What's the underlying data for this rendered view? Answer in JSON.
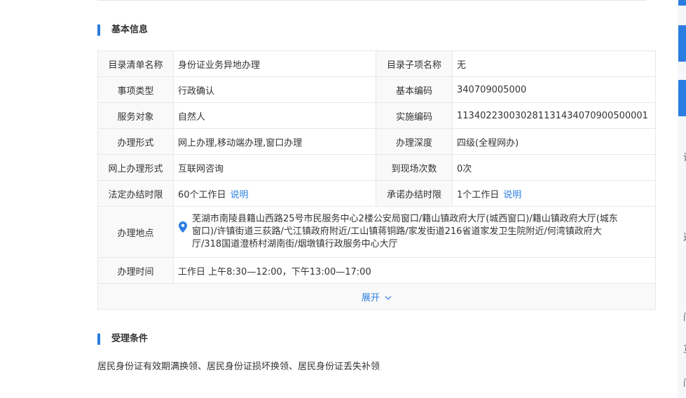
{
  "basic_info": {
    "title": "基本信息",
    "rows": [
      {
        "label1": "目录清单名称",
        "value1": "身份证业务异地办理",
        "label2": "目录子项名称",
        "value2": "无"
      },
      {
        "label1": "事项类型",
        "value1": "行政确认",
        "label2": "基本编码",
        "value2": "340709005000"
      },
      {
        "label1": "服务对象",
        "value1": "自然人",
        "label2": "实施编码",
        "value2": "11340223003028113143407090050000​1"
      },
      {
        "label1": "办理形式",
        "value1": "网上办理,移动端办理,窗口办理",
        "label2": "办理深度",
        "value2": "四级(全程网办)"
      },
      {
        "label1": "网上办理形式",
        "value1": "互联网咨询",
        "label2": "到现场次数",
        "value2": "0次"
      }
    ],
    "time_limit": {
      "label1": "法定办结时限",
      "value1": "60个工作日",
      "link1": "说明",
      "label2": "承诺办结时限",
      "value2": "1个工作日",
      "link2": "说明"
    },
    "location": {
      "label": "办理地点",
      "icon": "location-pin-icon",
      "value": "芜湖市南陵县籍山西路25号市民服务中心2楼公安局窗口/籍山镇政府大厅(城西窗口)/籍山镇政府大厅(城东窗口)/许镇街道三荻路/弋江镇政府附近/工山镇蒋铜路/家发街道216省道家发卫生院附近/何湾镇政府大厅/318国道澄桥村湖南街/烟墩镇行政服务中心大厅"
    },
    "hours": {
      "label": "办理时间",
      "value": "工作日 上午8:30—12:00，下午13:00—17:00"
    },
    "expand": {
      "label": "展开",
      "icon": "chevron-down-icon"
    }
  },
  "conditions": {
    "title": "受理条件",
    "text": "居民身份证有效期满换领、居民身份证损坏换领、居民身份证丢失补领"
  },
  "sidebar_chars": [
    "诊",
    "迟",
    "问",
    "互",
    "问"
  ],
  "colors": {
    "accent": "#2b7de1",
    "label_bg": "#f9f9f9",
    "border": "#e8e8e8"
  }
}
